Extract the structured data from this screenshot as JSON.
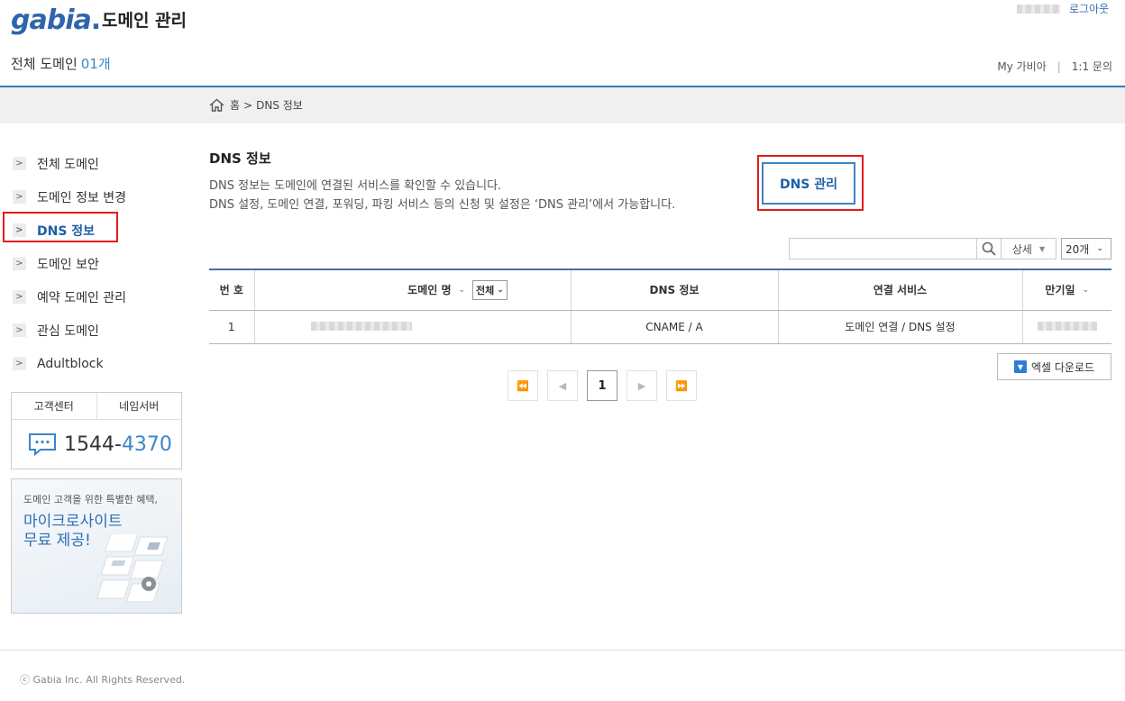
{
  "header": {
    "logo_text": "gabia",
    "app_title": "도메인 관리",
    "logout": "로그아웃",
    "domain_count_label": "전체 도메인",
    "domain_count": "01개",
    "links": {
      "my_gabia": "My 가비아",
      "separator": "|",
      "support": "1:1 문의"
    }
  },
  "breadcrumb": {
    "home": "홈",
    "separator": ">",
    "current": "DNS 정보"
  },
  "sidebar": {
    "items": [
      {
        "label": "전체 도메인"
      },
      {
        "label": "도메인 정보 변경"
      },
      {
        "label": "DNS 정보"
      },
      {
        "label": "도메인 보안"
      },
      {
        "label": "예약 도메인 관리"
      },
      {
        "label": "관심 도메인"
      },
      {
        "label": "Adultblock"
      }
    ],
    "contact": {
      "tab1": "고객센터",
      "tab2": "네임서버",
      "phone_a": "1544-",
      "phone_b": "4370"
    },
    "promo": {
      "subtitle": "도메인 고객을 위한 특별한 혜택,",
      "title_line1": "마이크로사이트",
      "title_line2": "무료 제공!"
    }
  },
  "main": {
    "title": "DNS 정보",
    "desc1": "DNS 정보는 도메인에 연결된 서비스를 확인할 수 있습니다.",
    "desc2": "DNS 설정, 도메인 연결, 포워딩, 파킹 서비스 등의 신청 및 설정은 ‘DNS 관리’에서 가능합니다.",
    "dns_manage_button": "DNS 관리",
    "search": {
      "placeholder": "",
      "detail_label": "상세",
      "page_size": "20개"
    },
    "table": {
      "headers": {
        "no": "번 호",
        "domain": "도메인 명",
        "filter": "전체",
        "dns": "DNS 정보",
        "service": "연결 서비스",
        "expiry": "만기일"
      },
      "rows": [
        {
          "no": "1",
          "dns": "CNAME / A",
          "service": "도메인 연결 / DNS 설정"
        }
      ]
    },
    "excel_button": "엑셀 다운로드",
    "pager": {
      "current": "1"
    }
  },
  "footer": {
    "copyright": "ⓒ Gabia Inc. All Rights Reserved."
  },
  "colors": {
    "accent": "#3b85c6",
    "highlight": "#e31b1b",
    "header_line": "#3a77b7"
  }
}
